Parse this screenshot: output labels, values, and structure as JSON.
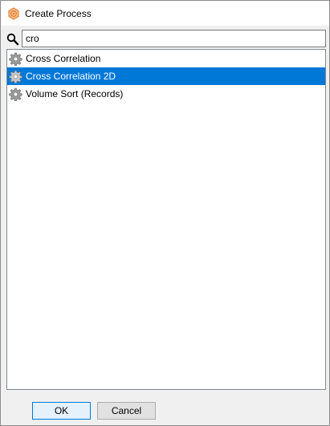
{
  "window": {
    "title": "Create Process",
    "title_icon": "process-app-icon"
  },
  "search": {
    "icon": "search-icon",
    "value": "cro",
    "placeholder": ""
  },
  "list": {
    "items": [
      {
        "label": "Cross Correlation",
        "icon": "gear-icon",
        "selected": false
      },
      {
        "label": "Cross Correlation 2D",
        "icon": "gear-icon",
        "selected": true
      },
      {
        "label": "Volume Sort (Records)",
        "icon": "gear-icon",
        "selected": false
      }
    ]
  },
  "buttons": {
    "ok_label": "OK",
    "cancel_label": "Cancel"
  },
  "colors": {
    "selection": "#0078d7",
    "app_icon": "#e8823a"
  }
}
